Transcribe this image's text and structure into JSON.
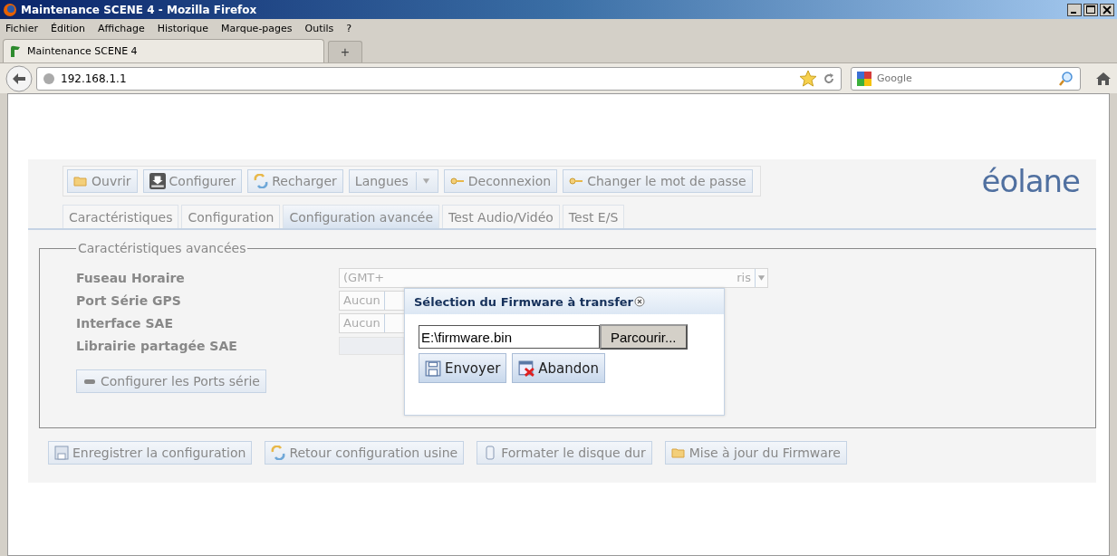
{
  "window": {
    "title": "Maintenance SCENE 4 - Mozilla Firefox"
  },
  "menu": [
    "Fichier",
    "Édition",
    "Affichage",
    "Historique",
    "Marque-pages",
    "Outils",
    "?"
  ],
  "browser_tabs": [
    {
      "label": "Maintenance SCENE 4",
      "selected": true
    }
  ],
  "new_tab": "+",
  "address": "192.168.1.1",
  "search": {
    "placeholder": "Google"
  },
  "toolbar": [
    {
      "label": "Ouvrir",
      "kind": "folder"
    },
    {
      "label": "Configurer",
      "kind": "download"
    },
    {
      "label": "Recharger",
      "kind": "reload"
    },
    {
      "label": "Langues",
      "kind": "dropdown"
    },
    {
      "label": "Deconnexion",
      "kind": "key"
    },
    {
      "label": "Changer le mot de passe",
      "kind": "key"
    }
  ],
  "logo": "éolane",
  "tabs": [
    {
      "label": "Caractéristiques",
      "selected": false
    },
    {
      "label": "Configuration",
      "selected": false
    },
    {
      "label": "Configuration avancée",
      "selected": true
    },
    {
      "label": "Test Audio/Vidéo",
      "selected": false
    },
    {
      "label": "Test E/S",
      "selected": false
    }
  ],
  "fieldset": {
    "legend": "Caractéristiques avancées",
    "rows": [
      {
        "label": "Fuseau Horaire",
        "kind": "select-wide",
        "value": "(GMT+",
        "tail": "ris"
      },
      {
        "label": "Port Série GPS",
        "kind": "select",
        "value": "Aucun"
      },
      {
        "label": "Interface SAE",
        "kind": "select",
        "value": "Aucun"
      },
      {
        "label": "Librairie partagée SAE",
        "kind": "bar"
      }
    ],
    "button": "Configurer les Ports série"
  },
  "actions": [
    {
      "label": "Enregistrer la configuration",
      "kind": "disk"
    },
    {
      "label": "Retour configuration usine",
      "kind": "reload"
    },
    {
      "label": "Formater le disque dur",
      "kind": "drive"
    },
    {
      "label": "Mise à jour du Firmware",
      "kind": "folder"
    }
  ],
  "dialog": {
    "title": "Sélection du Firmware à transfer",
    "file": "E:\\firmware.bin",
    "browse": "Parcourir...",
    "buttons": [
      {
        "label": "Envoyer",
        "kind": "disk"
      },
      {
        "label": "Abandon",
        "kind": "cancel"
      }
    ]
  }
}
